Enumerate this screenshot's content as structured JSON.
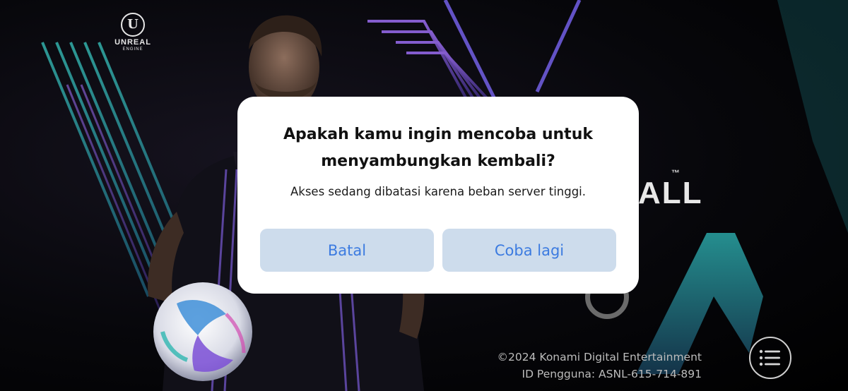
{
  "engine_logo": {
    "glyph": "U",
    "name": "UNREAL",
    "sub": "ENGINE"
  },
  "background": {
    "trademark": "™",
    "logo_fragment": "ALL"
  },
  "dialog": {
    "title": "Apakah kamu ingin mencoba untuk menyambungkan kembali?",
    "message": "Akses sedang dibatasi karena beban server tinggi.",
    "cancel_label": "Batal",
    "retry_label": "Coba lagi"
  },
  "footer": {
    "copyright": "©2024 Konami Digital Entertainment",
    "user_id": "ID Pengguna: ASNL-615-714-891"
  },
  "colors": {
    "button_bg": "#cddcec",
    "button_text": "#3c7be0",
    "accent_purple": "#7b4fd6",
    "accent_teal": "#2fb6b0"
  },
  "icons": {
    "menu": "list-menu-icon",
    "engine": "unreal-engine-logo",
    "loading": "loading-ring-icon"
  }
}
